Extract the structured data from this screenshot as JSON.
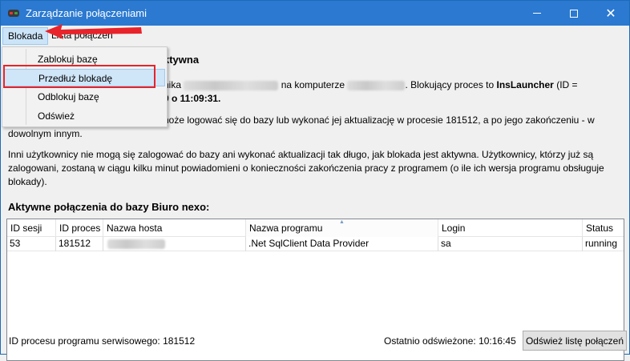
{
  "window": {
    "title": "Zarządzanie połączeniami"
  },
  "menu": {
    "items": [
      "Blokada",
      "Lista połączeń"
    ]
  },
  "dropdown": {
    "items": [
      "Zablokuj bazę",
      "Przedłuż blokadę",
      "Odblokuj bazę",
      "Odśwież"
    ]
  },
  "info": {
    "heading_visible": "ktywna",
    "line1_a": "nika",
    "line1_b": "na komputerze",
    "line1_c": ". Blokujący proces to",
    "line1_proc": "InsLauncher",
    "line1_d": "(ID =",
    "line2": "9 o 11:09:31.",
    "line3": "noże logować się do bazy lub wykonać jej aktualizację w procesie 181512, a po jego zakończeniu - w",
    "line4": "dowolnym innym.",
    "line5": "Inni użytkownicy nie mogą się zalogować do bazy ani wykonać aktualizacji tak długo, jak blokada jest aktywna. Użytkownicy, którzy już są",
    "line6": "zalogowani, zostaną w ciągu kilku minut powiadomieni o konieczności zakończenia pracy z programem (o ile ich wersja programu obsługuje",
    "line7": "blokady)."
  },
  "grid": {
    "title": "Aktywne połączenia do bazy Biuro nexo:",
    "columns": [
      "ID sesji",
      "ID proces",
      "Nazwa hosta",
      "Nazwa programu",
      "Login",
      "Status"
    ],
    "rows": [
      {
        "id_sesji": "53",
        "id_proces": "181512",
        "program": ".Net SqlClient Data Provider",
        "login": "sa",
        "status": "running"
      }
    ]
  },
  "status": {
    "left": "ID procesu programu serwisowego: 181512",
    "right": "Ostatnio odświeżone: 10:16:45",
    "button": "Odśwież listę połączeń"
  },
  "colors": {
    "titlebar": "#2b79d0",
    "highlight_box": "#e8232a",
    "arrow": "#e8232a"
  }
}
